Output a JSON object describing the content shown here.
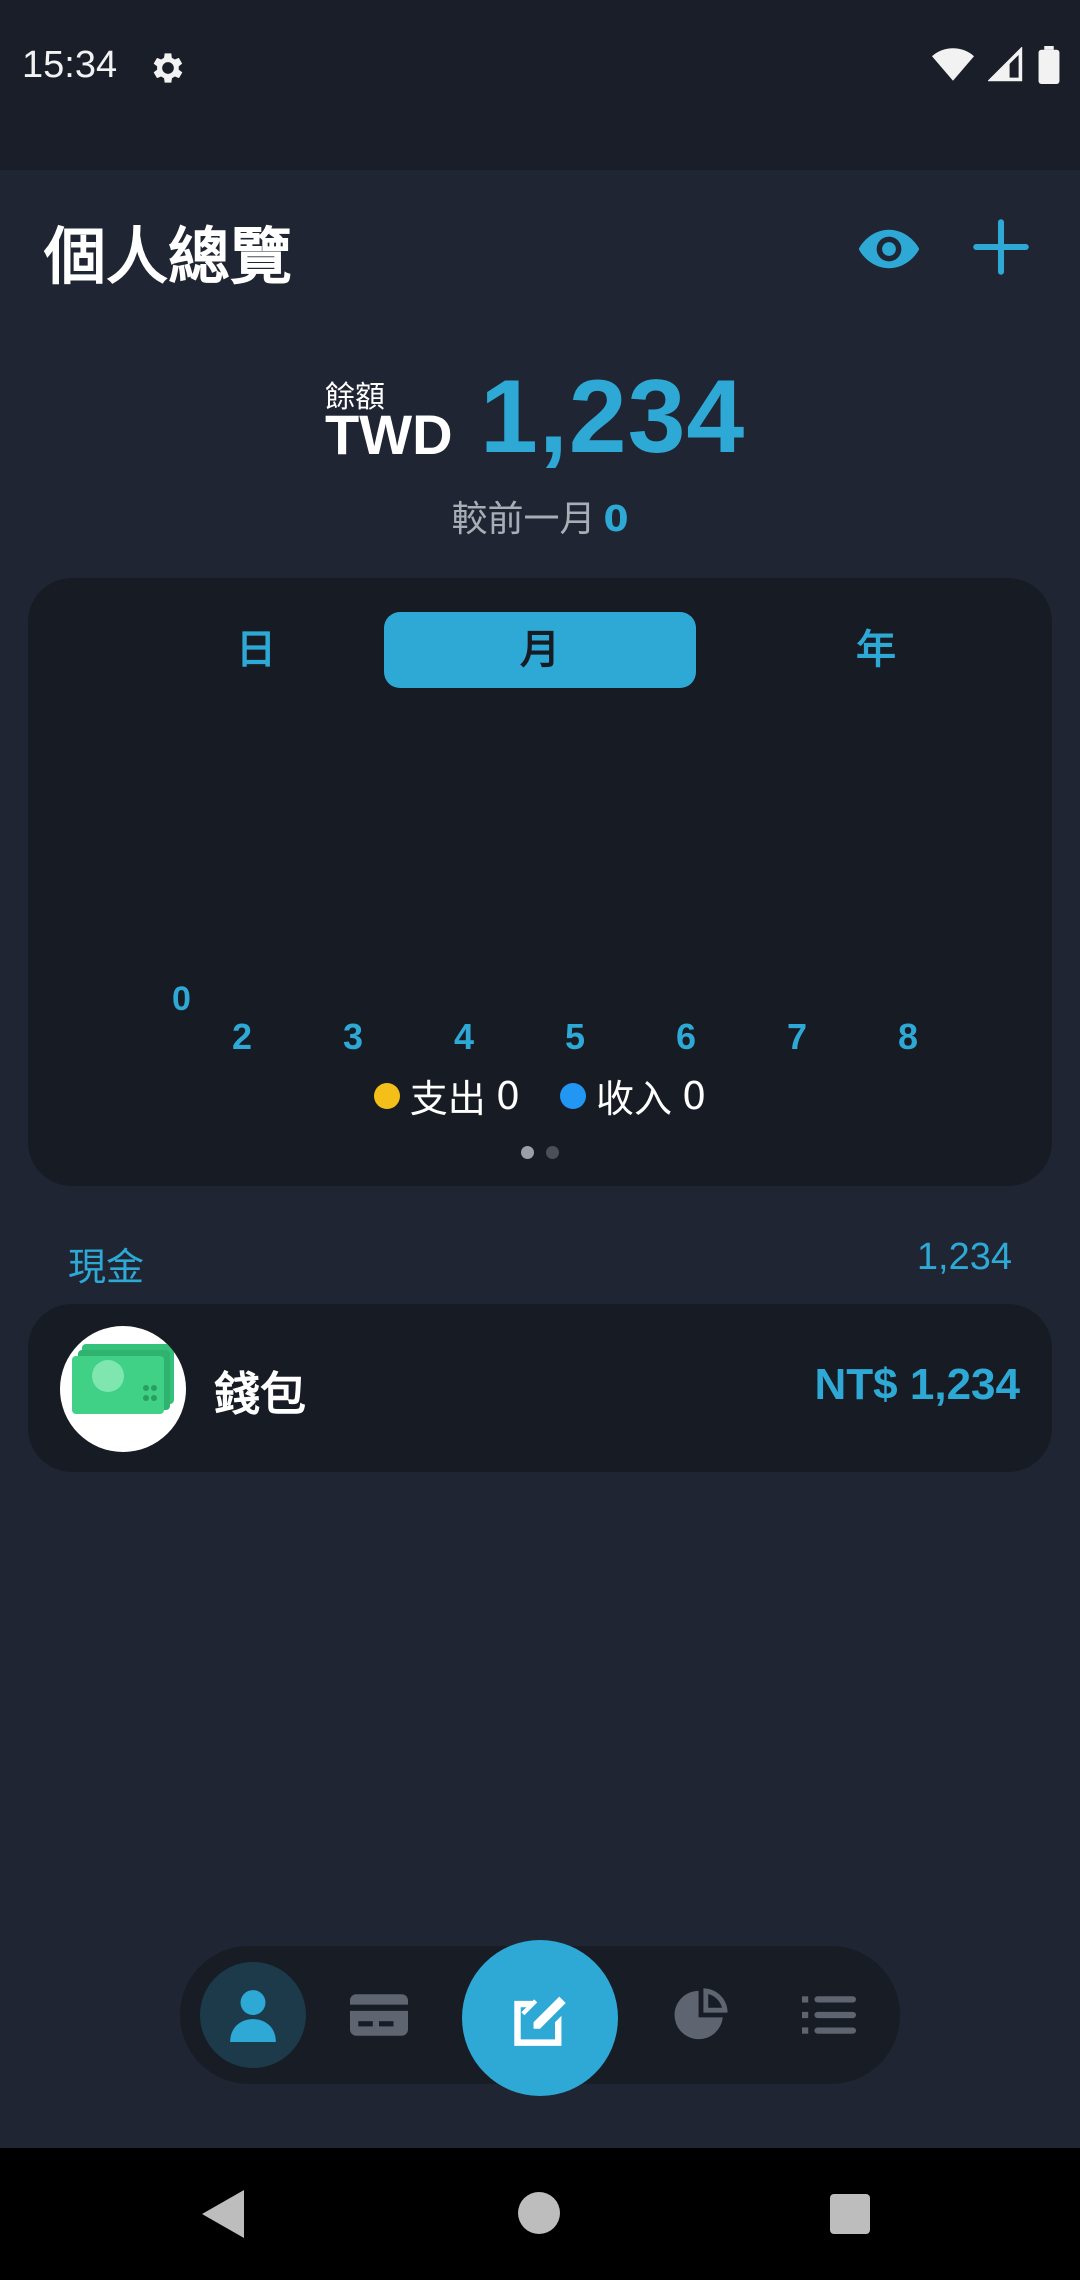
{
  "status_bar": {
    "time": "15:34"
  },
  "header": {
    "title": "個人總覽"
  },
  "balance": {
    "label": "餘額",
    "currency": "TWD",
    "amount": "1,234",
    "compare_label": "較前一月",
    "compare_value": "0"
  },
  "period_tabs": {
    "day": "日",
    "month": "月",
    "year": "年",
    "selected": "月"
  },
  "chart_data": {
    "type": "bar",
    "categories": [
      "2",
      "3",
      "4",
      "5",
      "6",
      "7",
      "8"
    ],
    "series": [
      {
        "name": "支出",
        "color": "#f5bf19",
        "values": [
          0,
          0,
          0,
          0,
          0,
          0,
          0
        ]
      },
      {
        "name": "收入",
        "color": "#2196f3",
        "values": [
          0,
          0,
          0,
          0,
          0,
          0,
          0
        ]
      }
    ],
    "y_tick_labels": [
      "0"
    ],
    "legend": [
      {
        "label": "支出",
        "value": "0",
        "color": "#f5bf19"
      },
      {
        "label": "收入",
        "value": "0",
        "color": "#2196f3"
      }
    ],
    "legend_position": "bottom",
    "grid": false
  },
  "pager": {
    "pages": 2,
    "current": 1
  },
  "cash_section": {
    "title": "現金",
    "total": "1,234"
  },
  "accounts": [
    {
      "name": "錢包",
      "amount": "NT$ 1,234",
      "icon": "cash-icon"
    }
  ],
  "bottom_nav": {
    "items": [
      {
        "name": "overview",
        "icon": "person-icon",
        "active": true
      },
      {
        "name": "cards",
        "icon": "credit-card-icon",
        "active": false
      },
      {
        "name": "add-transaction",
        "icon": "new-record-icon",
        "active": false
      },
      {
        "name": "statistics",
        "icon": "pie-chart-icon",
        "active": false
      },
      {
        "name": "menu",
        "icon": "list-icon",
        "active": false
      }
    ]
  },
  "colors": {
    "accent": "#2ea9d6",
    "background": "#1f2532",
    "card": "#161b24",
    "expense": "#f5bf19",
    "income": "#2196f3"
  }
}
